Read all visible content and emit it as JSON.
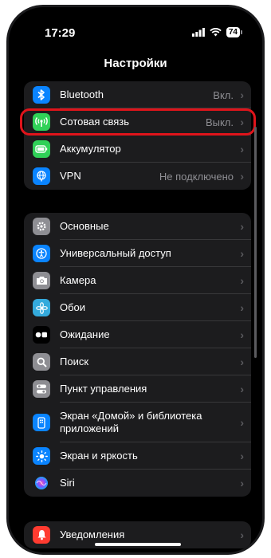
{
  "status": {
    "time": "17:29",
    "battery": "74"
  },
  "nav": {
    "title": "Настройки"
  },
  "groups": [
    {
      "rows": [
        {
          "label": "Bluetooth",
          "value": "Вкл.",
          "icon": "bluetooth-icon",
          "color": "#0a84ff"
        },
        {
          "label": "Сотовая связь",
          "value": "Выкл.",
          "icon": "antenna-icon",
          "color": "#30d158"
        },
        {
          "label": "Аккумулятор",
          "value": "",
          "icon": "battery-icon",
          "color": "#30d158"
        },
        {
          "label": "VPN",
          "value": "Не подключено",
          "icon": "globe-icon",
          "color": "#0a84ff"
        }
      ]
    },
    {
      "rows": [
        {
          "label": "Основные",
          "icon": "gear-icon",
          "color": "#8e8e93"
        },
        {
          "label": "Универсальный доступ",
          "icon": "accessibility-icon",
          "color": "#0a84ff"
        },
        {
          "label": "Камера",
          "icon": "camera-icon",
          "color": "#8e8e93"
        },
        {
          "label": "Обои",
          "icon": "flower-icon",
          "color": "#34aadc"
        },
        {
          "label": "Ожидание",
          "icon": "standby-icon",
          "color": "#000000"
        },
        {
          "label": "Поиск",
          "icon": "search-icon",
          "color": "#8e8e93"
        },
        {
          "label": "Пункт управления",
          "icon": "toggles-icon",
          "color": "#8e8e93"
        },
        {
          "label": "Экран «Домой» и библиотека приложений",
          "icon": "homescreen-icon",
          "color": "#0a84ff"
        },
        {
          "label": "Экран и яркость",
          "icon": "sun-icon",
          "color": "#0a84ff"
        },
        {
          "label": "Siri",
          "icon": "siri-icon",
          "color": "#2c2c2e"
        }
      ]
    },
    {
      "rows": [
        {
          "label": "Уведомления",
          "icon": "bell-icon",
          "color": "#ff3b30"
        }
      ]
    }
  ]
}
